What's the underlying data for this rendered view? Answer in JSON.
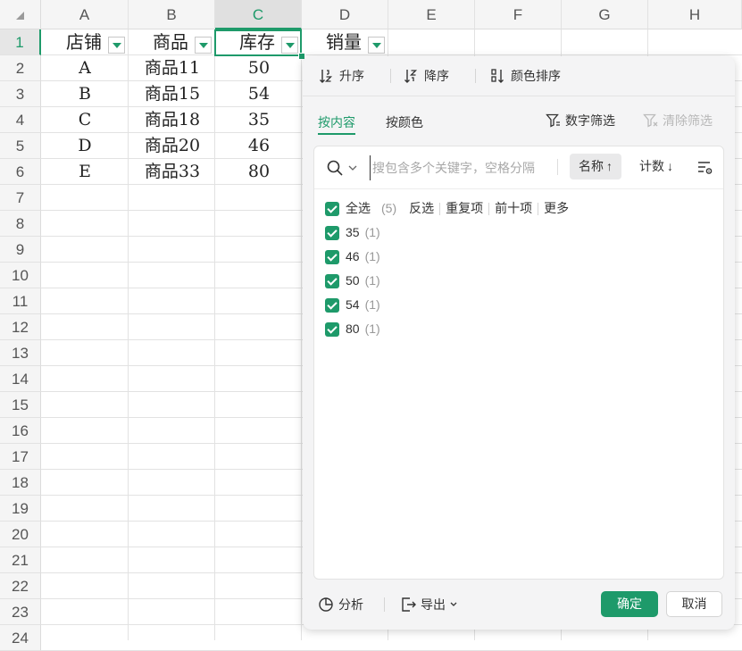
{
  "sheet": {
    "columns": [
      "A",
      "B",
      "C",
      "D",
      "E",
      "F",
      "G",
      "H"
    ],
    "rows": [
      "1",
      "2",
      "3",
      "4",
      "5",
      "6",
      "7",
      "8",
      "9",
      "10",
      "11",
      "12",
      "13",
      "14",
      "15",
      "16",
      "17",
      "18",
      "19",
      "20",
      "21",
      "22",
      "23",
      "24"
    ],
    "headers": [
      "店铺",
      "商品",
      "库存",
      "销量"
    ],
    "data": [
      [
        "A",
        "商品11",
        "50"
      ],
      [
        "B",
        "商品15",
        "54"
      ],
      [
        "C",
        "商品18",
        "35"
      ],
      [
        "D",
        "商品20",
        "46"
      ],
      [
        "E",
        "商品33",
        "80"
      ]
    ]
  },
  "sort": {
    "ascending": "升序",
    "descending": "降序",
    "by_color": "颜色排序"
  },
  "tabs": {
    "by_content": "按内容",
    "by_color": "按颜色"
  },
  "tools": {
    "number_filter": "数字筛选",
    "clear_filter": "清除筛选"
  },
  "search": {
    "placeholder": "搜包含多个关键字，空格分隔",
    "sort_name": "名称",
    "sort_count": "计数"
  },
  "list": {
    "select_all": "全选",
    "select_all_count": "(5)",
    "quick": [
      "反选",
      "重复项",
      "前十项",
      "更多"
    ],
    "items": [
      {
        "label": "35",
        "count": "(1)"
      },
      {
        "label": "46",
        "count": "(1)"
      },
      {
        "label": "50",
        "count": "(1)"
      },
      {
        "label": "54",
        "count": "(1)"
      },
      {
        "label": "80",
        "count": "(1)"
      }
    ]
  },
  "footer": {
    "analyze": "分析",
    "export": "导出",
    "ok": "确定",
    "cancel": "取消"
  },
  "colors": {
    "accent": "#1e9a6a"
  }
}
